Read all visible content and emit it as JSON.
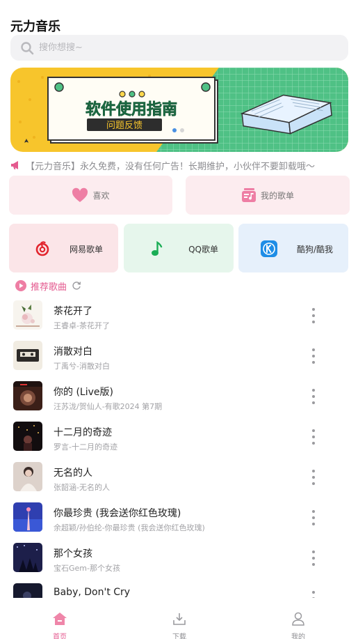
{
  "app": {
    "title": "元力音乐"
  },
  "search": {
    "placeholder": "搜你想搜~"
  },
  "banner": {
    "title": "软件使用指南",
    "subtitle": "问题反馈",
    "slide_count": 2,
    "active_slide": 1
  },
  "notice": {
    "text": "【元力音乐】永久免费，没有任何广告！长期维护，小伙伴不要卸载哦～"
  },
  "quick_actions": [
    {
      "label": "喜欢",
      "icon": "heart-icon"
    },
    {
      "label": "我的歌单",
      "icon": "playlist-icon"
    }
  ],
  "sources": [
    {
      "label": "网易歌单",
      "icon": "netease-icon"
    },
    {
      "label": "QQ歌单",
      "icon": "qq-music-icon"
    },
    {
      "label": "酷狗/酷我",
      "icon": "kugou-icon"
    }
  ],
  "section": {
    "title": "推荐歌曲"
  },
  "songs": [
    {
      "title": "茶花开了",
      "subtitle": "王睿卓-茶花开了"
    },
    {
      "title": "消散对白",
      "subtitle": "丁禹兮-消散对白"
    },
    {
      "title": "你的 (Live版)",
      "subtitle": "汪苏泷/贺仙人-有歌2024 第7期"
    },
    {
      "title": "十二月的奇迹",
      "subtitle": "罗言-十二月的奇迹"
    },
    {
      "title": "无名的人",
      "subtitle": "张韶涵-无名的人"
    },
    {
      "title": "你最珍贵 (我会送你红色玫瑰)",
      "subtitle": "余超颖/孙伯纶-你最珍贵 (我会送你红色玫瑰)"
    },
    {
      "title": "那个女孩",
      "subtitle": "宝石Gem-那个女孩"
    },
    {
      "title": "Baby, Don't Cry",
      "subtitle": ""
    }
  ],
  "tabbar": [
    {
      "label": "首页",
      "active": true
    },
    {
      "label": "下载",
      "active": false
    },
    {
      "label": "我的",
      "active": false
    }
  ],
  "colors": {
    "accent": "#e45a8f",
    "banner_yellow": "#f7c52c",
    "banner_green": "#4fc185",
    "banner_title": "#22a768"
  }
}
